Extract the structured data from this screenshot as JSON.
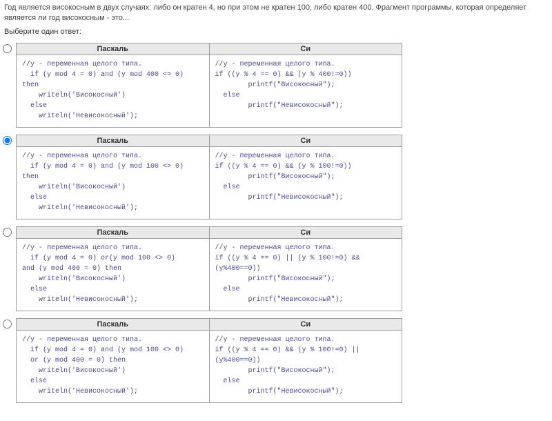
{
  "question": {
    "stem": "Год является високосным в двух случаях: либо он кратен 4, но при этом не кратен 100, либо кратен 400. Фрагмент программы, которая определяет является ли год високосным - это...",
    "prompt": "Выберите один ответ:"
  },
  "headers": {
    "pascal": "Паскаль",
    "c": "Си"
  },
  "options": [
    {
      "checked": false,
      "pascal": "//y - переменная целого типа.\n  if (y mod 4 = 0) and (y mod 400 <> 0)\nthen\n    writeln('Високосный')\n  else\n    writeln('Невисокосный');",
      "c": "//y - переменная целого типа.\nif ((y % 4 == 0) && (y % 400!=0))\n        printf(\"Високосный\");\n  else\n        printf(\"Невисокосный\");"
    },
    {
      "checked": true,
      "pascal": "//y - переменная целого типа.\n  if (y mod 4 = 0) and (y mod 100 <> 0)\nthen\n    writeln('Високосный')\n  else\n    writeln('Невисокосный');",
      "c": "//y - переменная целого типа.\nif ((y % 4 == 0) && (y % 100!=0))\n        printf(\"Високосный\");\n  else\n        printf(\"Невисокосный\");"
    },
    {
      "checked": false,
      "pascal": "//y - переменная целого типа.\n  if (y mod 4 = 0) or(y mod 100 <> 0)\nand (y mod 400 = 0) then\n    writeln('Високосный')\n  else\n    writeln('Невисокосный');",
      "c": "//y - переменная целого типа.\nif ((y % 4 == 0) || (y % 100!=0) &&\n(y%400==0))\n        printf(\"Високосный\");\n  else\n        printf(\"Невисокосный\");"
    },
    {
      "checked": false,
      "pascal": "//y - переменная целого типа.\n  if (y mod 4 = 0) and (y mod 100 <> 0)\n  or (y mod 400 = 0) then\n    writeln('Високосный')\n  else\n    writeln('Невисокосный');",
      "c": "//y - переменная целого типа.\nif ((y % 4 == 0) && (y % 100!=0) ||\n(y%400==0))\n        printf(\"Високосный\");\n  else\n        printf(\"Невисокосный\");"
    }
  ]
}
